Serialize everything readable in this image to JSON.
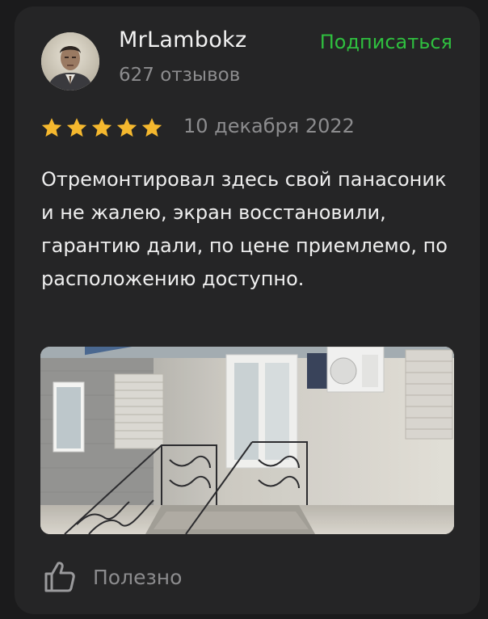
{
  "author": {
    "name": "MrLambokz",
    "reviews_count": "627 отзывов"
  },
  "subscribe_label": "Подписаться",
  "rating": {
    "stars": 5,
    "max": 5
  },
  "date": "10 декабря 2022",
  "review_text": "Отремонтировал здесь свой панасоник и не жалею, экран восстановили, гарантию дали, по цене приемлемо, по расположению доступно.",
  "helpful_label": "Полезно",
  "colors": {
    "accent_green": "#2fbf3f",
    "star": "#f5b82e",
    "card_bg": "#252526",
    "page_bg": "#1b1b1c"
  }
}
